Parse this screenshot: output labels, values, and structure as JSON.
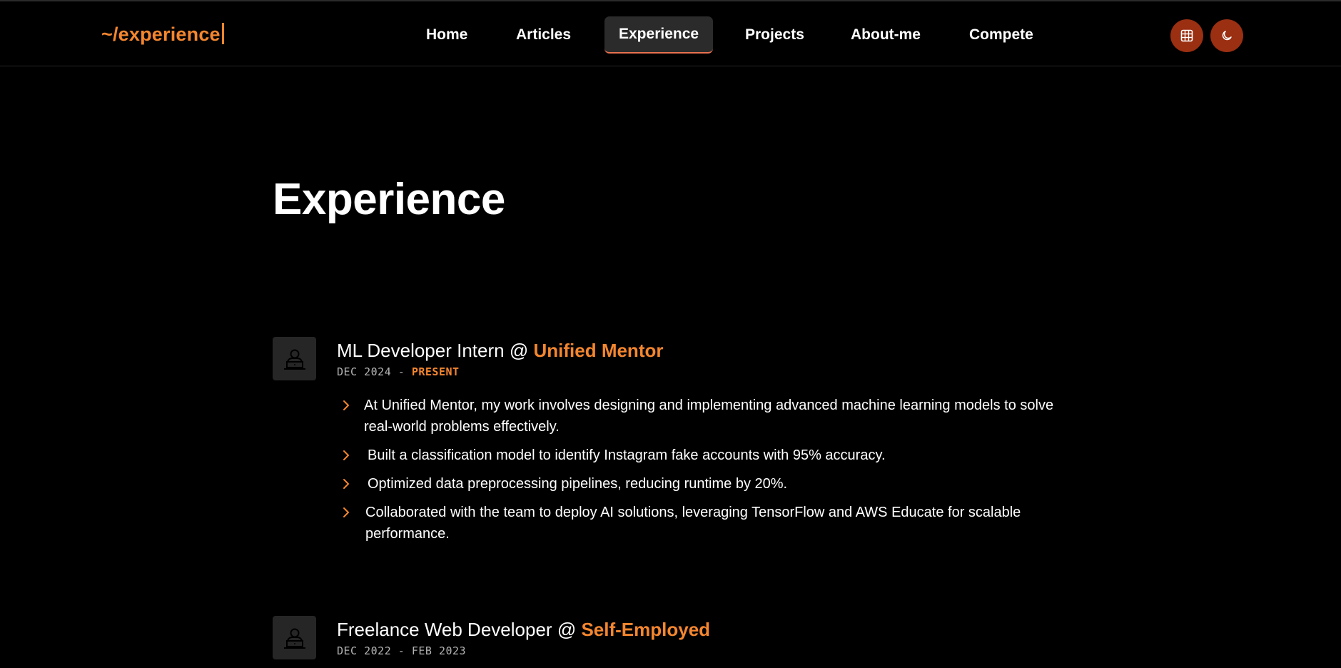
{
  "header": {
    "logo": "~/experience",
    "nav": [
      {
        "label": "Home",
        "active": false
      },
      {
        "label": "Articles",
        "active": false
      },
      {
        "label": "Experience",
        "active": true
      },
      {
        "label": "Projects",
        "active": false
      },
      {
        "label": "About-me",
        "active": false
      },
      {
        "label": "Compete",
        "active": false
      }
    ],
    "actions": [
      {
        "icon": "grid-icon"
      },
      {
        "icon": "moon-icon"
      }
    ]
  },
  "page": {
    "title": "Experience"
  },
  "experiences": [
    {
      "role": "ML Developer Intern",
      "separator": "@",
      "company": "Unified Mentor",
      "date_start": "DEC 2024",
      "date_sep": "-",
      "date_end": "PRESENT",
      "bullets": [
        "At Unified Mentor, my work involves designing and implementing advanced machine learning models to solve real-world problems effectively.",
        "Built a classification model to identify Instagram fake accounts with 95% accuracy.",
        "Optimized data preprocessing pipelines, reducing runtime by 20%.",
        "Collaborated with the team to deploy AI solutions, leveraging TensorFlow and AWS Educate for scalable performance."
      ]
    },
    {
      "role": "Freelance Web Developer",
      "separator": "@",
      "company": "Self-Employed",
      "date_start": "DEC 2022",
      "date_sep": "-",
      "date_end": "FEB 2023"
    }
  ],
  "colors": {
    "accent": "#f4862f",
    "icon_button_bg": "#9a2f12",
    "active_tab_bg": "#2b2b2b",
    "active_tab_underline": "#e8714f",
    "background": "#000000"
  }
}
